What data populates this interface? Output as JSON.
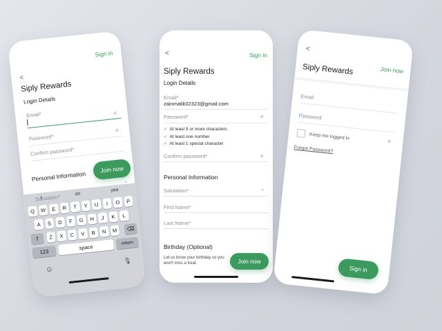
{
  "screen1": {
    "sign_in": "Sign in",
    "back": "<",
    "title": "Siply Rewards",
    "section_login": "Login Details",
    "email_label": "Email*",
    "password_label": "Password*",
    "confirm_label": "Confirm password*",
    "section_personal": "Personal Information",
    "join_button": "Join now",
    "salutation_label": "Salutation*",
    "suggestions": [
      "I",
      "oh",
      "yea"
    ],
    "keys_row1": [
      "Q",
      "W",
      "E",
      "R",
      "T",
      "Y",
      "U",
      "I",
      "O",
      "P"
    ],
    "keys_row2": [
      "A",
      "S",
      "D",
      "F",
      "G",
      "H",
      "J",
      "K",
      "L"
    ],
    "keys_row3": [
      "Z",
      "X",
      "C",
      "V",
      "B",
      "N",
      "M"
    ],
    "key_numbers": "123",
    "key_space": "space",
    "key_return": "return",
    "key_shift": "⇧",
    "key_delete": "⌫",
    "key_emoji": "☺",
    "key_mic": "🎙"
  },
  "screen2": {
    "back": "<",
    "sign_in": "Sign in",
    "title": "Siply Rewards",
    "section_login": "Login Details",
    "email_label": "Email*",
    "email_value": "zainmalik02323@gmail.com",
    "password_label": "Password*",
    "requirements": [
      "At least 9 or more characters",
      "At least one number",
      "At least 1 special character"
    ],
    "confirm_label": "Confirm password*",
    "section_personal": "Personal Information",
    "salutation_label": "Salutation*",
    "first_name_label": "First Name*",
    "last_name_label": "Last Name*",
    "section_birthday": "Birthday (Optional)",
    "birthday_note": "Let us know your birthday so you won't miss a treat.",
    "join_button": "Join now"
  },
  "screen3": {
    "back": "<",
    "join_now": "Join now",
    "title": "Siply Rewards",
    "email_label": "Email",
    "password_label": "Password",
    "keep_logged_in": "Keep me logged in",
    "forgot_password": "Forgot Password?",
    "sign_in_button": "Sign in"
  },
  "colors": {
    "accent": "#3c9a5f",
    "background": "#d8dbe2"
  }
}
